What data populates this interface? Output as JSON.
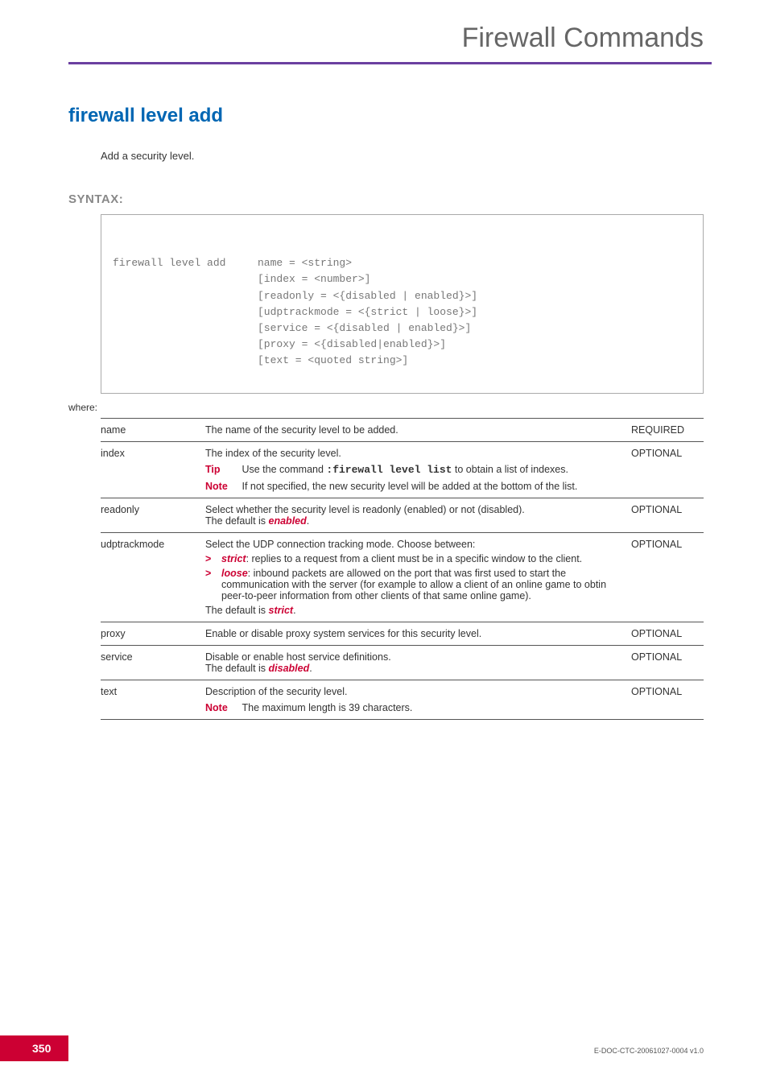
{
  "header": {
    "title": "Firewall Commands"
  },
  "command": {
    "title": "firewall level add",
    "description": "Add a security level."
  },
  "syntax": {
    "label": "SYNTAX:",
    "command": "firewall level add",
    "args": "name = <string>\n[index = <number>]\n[readonly = <{disabled | enabled}>]\n[udptrackmode = <{strict | loose}>]\n[service = <{disabled | enabled}>]\n[proxy = <{disabled|enabled}>]\n[text = <quoted string>]"
  },
  "where_label": "where:",
  "params": {
    "name": {
      "label": "name",
      "desc": "The name of the security level to be added.",
      "req": "REQUIRED"
    },
    "index": {
      "label": "index",
      "desc": "The index of the security level.",
      "tip_label": "Tip",
      "tip_pre": "Use the command ",
      "tip_cmd": ":firewall level list",
      "tip_post": " to obtain a list of indexes.",
      "note_label": "Note",
      "note": "If not specified, the new security level will be added at the bottom of the list.",
      "req": "OPTIONAL"
    },
    "readonly": {
      "label": "readonly",
      "desc_pre": "Select whether the security level is readonly (enabled) or not (disabled).",
      "default_pre": "The default is ",
      "default_val": "enabled",
      "default_post": ".",
      "req": "OPTIONAL"
    },
    "udptrackmode": {
      "label": "udptrackmode",
      "desc": "Select the UDP connection tracking mode. Choose between:",
      "opt1_key": "strict",
      "opt1_body": ": replies to a request from a client must be in a specific window to the client.",
      "opt2_key": "loose",
      "opt2_body": ": inbound packets are allowed on the port that was first used to start the communication with the server (for example to allow a client of an online game to obtin peer-to-peer information from other clients of that same online game).",
      "default_pre": "The default is ",
      "default_val": "strict",
      "default_post": ".",
      "req": "OPTIONAL"
    },
    "proxy": {
      "label": "proxy",
      "desc": "Enable or disable proxy system services for this security level.",
      "req": "OPTIONAL"
    },
    "service": {
      "label": "service",
      "desc": "Disable or enable host service definitions.",
      "default_pre": "The default is ",
      "default_val": "disabled",
      "default_post": ".",
      "req": "OPTIONAL"
    },
    "text": {
      "label": "text",
      "desc": "Description of the security level.",
      "note_label": "Note",
      "note": "The maximum length is 39 characters.",
      "req": "OPTIONAL"
    }
  },
  "footer": {
    "page": "350",
    "docid": "E-DOC-CTC-20061027-0004 v1.0"
  }
}
